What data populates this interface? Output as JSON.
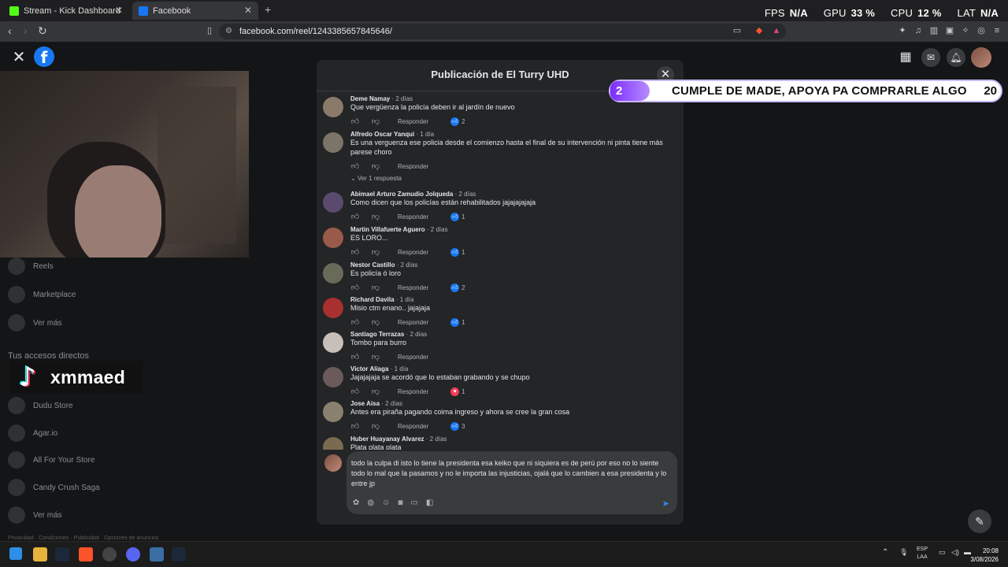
{
  "browser": {
    "tabs": [
      {
        "label": "Stream - Kick Dashboard",
        "favicon_color": "#53fc18"
      },
      {
        "label": "Facebook",
        "favicon_color": "#1877f2"
      }
    ],
    "url": "facebook.com/reel/1243385657845646/"
  },
  "overlay_stats": {
    "fps_label": "FPS",
    "fps_value": "N/A",
    "gpu_label": "GPU",
    "gpu_value": "33 %",
    "cpu_label": "CPU",
    "cpu_value": "12 %",
    "lat_label": "LAT",
    "lat_value": "N/A"
  },
  "left_nav": {
    "items": [
      {
        "label": "Reels"
      },
      {
        "label": "Marketplace"
      },
      {
        "label": "Ver más"
      }
    ],
    "shortcuts_header": "Tus accesos directos",
    "shortcuts": [
      {
        "label": "Dudu Store"
      },
      {
        "label": "Agar.io"
      },
      {
        "label": "All For Your Store"
      },
      {
        "label": "Candy Crush Saga"
      },
      {
        "label": "Ver más"
      }
    ],
    "footer": "Privacidad · Condiciones · Publicidad · Opciones de anuncios"
  },
  "tiktok_overlay": {
    "username": "xmmaed"
  },
  "banner": {
    "left_number": "2",
    "text": "CUMPLE DE MADE, APOYA PA COMPRARLE ALGO",
    "right_number": "20"
  },
  "modal": {
    "title": "Publicación de El Turry UHD",
    "reply_label": "Responder",
    "view_replies": "Ver 1 respuesta",
    "comments": [
      {
        "author": "Deme Namay",
        "time": "2 días",
        "text": "Que vergüenza la policía deben ir al jardín de nuevo",
        "reactions": "2",
        "reaction_type": "like",
        "avatar_color": "#8a7a6a"
      },
      {
        "author": "Alfredo Oscar Yanqui",
        "time": "1 día",
        "text": "Es una verguenza ese policia desde el comienzo hasta el final de su intervención ni pinta tiene más parese choro",
        "reactions": "",
        "reaction_type": "none",
        "avatar_color": "#7c7468"
      },
      {
        "author": "Abimael Arturo Zamudio Jolqueda",
        "time": "2 días",
        "text": "Como dicen que los policías están rehabilitados jajajajajaja",
        "reactions": "1",
        "reaction_type": "like",
        "avatar_color": "#5a4a6e"
      },
      {
        "author": "Martin Villafuerte Aguero",
        "time": "2 días",
        "text": "ES LORO...",
        "reactions": "1",
        "reaction_type": "like",
        "avatar_color": "#9a5a4a"
      },
      {
        "author": "Nestor Castillo",
        "time": "2 días",
        "text": "Es policía ó loro",
        "reactions": "2",
        "reaction_type": "like",
        "avatar_color": "#6a6a5a"
      },
      {
        "author": "Richard Davila",
        "time": "1 día",
        "text": "Misio ctm enano.. jajajaja",
        "reactions": "1",
        "reaction_type": "like",
        "avatar_color": "#a83030"
      },
      {
        "author": "Santiago Terrazas",
        "time": "2 días",
        "text": "Tombo para burro",
        "reactions": "",
        "reaction_type": "none",
        "avatar_color": "#c8c0b8"
      },
      {
        "author": "Victor Aliaga",
        "time": "1 día",
        "text": "Jajajajaja se acordó que lo estaban grabando y se chupo",
        "reactions": "1",
        "reaction_type": "love",
        "avatar_color": "#6a5a5a"
      },
      {
        "author": "Jose Aisa",
        "time": "2 días",
        "text": "Antes era piraña pagando coima ingreso y ahora se cree la gran cosa",
        "reactions": "3",
        "reaction_type": "like",
        "avatar_color": "#8a8070"
      },
      {
        "author": "Huber Huayanay Alvarez",
        "time": "2 días",
        "text": "Plata plata plata",
        "reactions": "",
        "reaction_type": "none",
        "avatar_color": "#7a6a50"
      }
    ],
    "composer_text": "todo la culpa di isto lo tiene la presidenta esa keiko que ni siquiera es de perú por eso no lo siente todo lo mal que la pasamos y no le importa las injusticias, ojalá que lo cambien a esa presidenta y lo entre jp"
  },
  "taskbar": {
    "lang": "ESP",
    "lang_sub": "LAA",
    "time": "20:08",
    "date": "3/08/2026"
  },
  "colors": {
    "accent": "#1877f2",
    "modal_bg": "#242526",
    "page_bg": "#18191a"
  }
}
